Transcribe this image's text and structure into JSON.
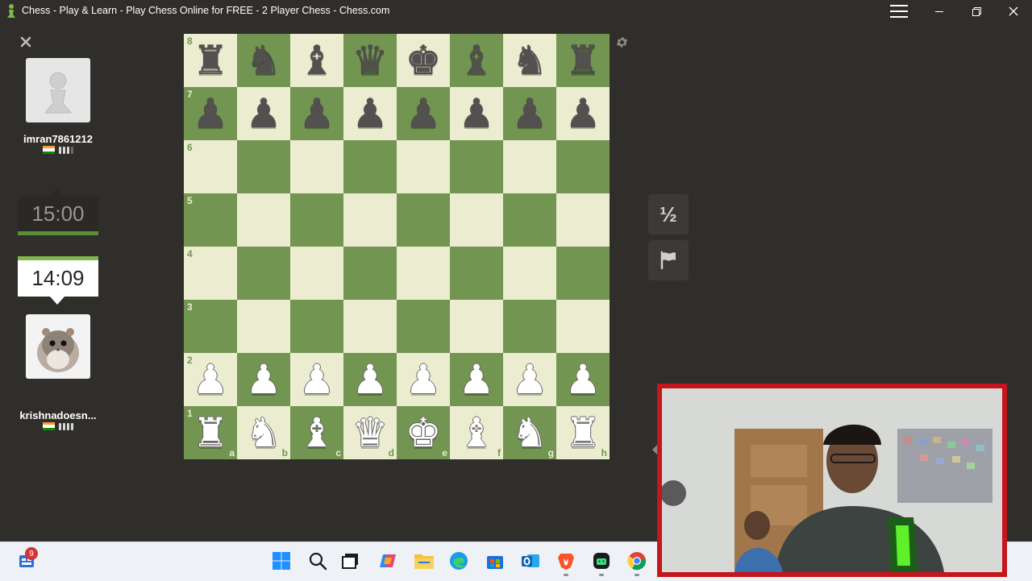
{
  "window": {
    "title": "Chess - Play & Learn - Play Chess Online for FREE - 2 Player Chess - Chess.com",
    "app_icon": "chess-pawn-icon",
    "controls": [
      "hamburger-menu-icon",
      "minimize-icon",
      "restore-icon",
      "close-icon"
    ]
  },
  "opponent": {
    "name": "imran7861212",
    "country_flag": "india-flag-icon",
    "clock": "15:00",
    "avatar": "pawn-avatar"
  },
  "player": {
    "name": "krishnadoesn...",
    "country_flag": "india-flag-icon",
    "clock": "14:09",
    "avatar": "hamster-avatar"
  },
  "board": {
    "colors": {
      "light": "#ebecd0",
      "dark": "#739552"
    },
    "ranks": [
      "8",
      "7",
      "6",
      "5",
      "4",
      "3",
      "2",
      "1"
    ],
    "files": [
      "a",
      "b",
      "c",
      "d",
      "e",
      "f",
      "g",
      "h"
    ],
    "position": [
      [
        "br",
        "bn",
        "bb",
        "bq",
        "bk",
        "bb",
        "bn",
        "br"
      ],
      [
        "bp",
        "bp",
        "bp",
        "bp",
        "bp",
        "bp",
        "bp",
        "bp"
      ],
      [
        "",
        "",
        "",
        "",
        "",
        "",
        "",
        ""
      ],
      [
        "",
        "",
        "",
        "",
        "",
        "",
        "",
        ""
      ],
      [
        "",
        "",
        "",
        "",
        "",
        "",
        "",
        ""
      ],
      [
        "",
        "",
        "",
        "",
        "",
        "",
        "",
        ""
      ],
      [
        "wp",
        "wp",
        "wp",
        "wp",
        "wp",
        "wp",
        "wp",
        "wp"
      ],
      [
        "wr",
        "wn",
        "wb",
        "wq",
        "wk",
        "wb",
        "wn",
        "wr"
      ]
    ]
  },
  "actions": {
    "draw_label": "½",
    "resign_icon": "flag-icon",
    "settings_icon": "gear-icon"
  },
  "taskbar": {
    "widget_badge": "9",
    "icons": [
      "windows-start-icon",
      "search-icon",
      "task-view-icon",
      "copilot-icon",
      "file-explorer-icon",
      "edge-icon",
      "microsoft-store-icon",
      "outlook-icon",
      "brave-icon",
      "android-app-icon",
      "chrome-icon"
    ]
  }
}
